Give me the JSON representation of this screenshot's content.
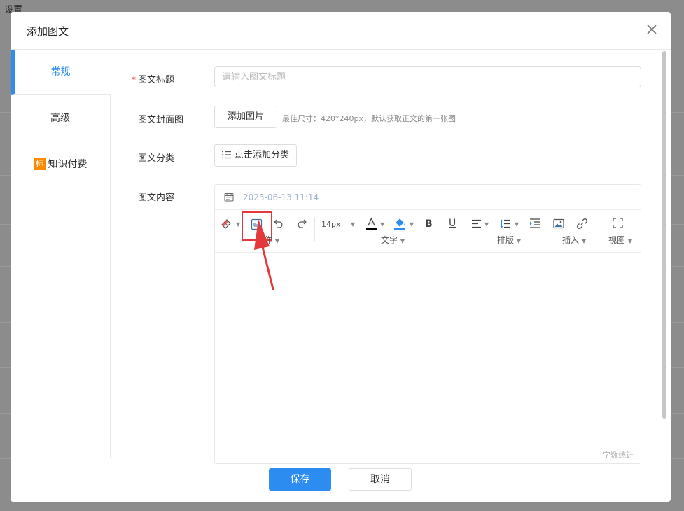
{
  "background": {
    "title": "设置"
  },
  "modal": {
    "title": "添加图文"
  },
  "sidebar": {
    "items": [
      {
        "label": "常规"
      },
      {
        "label": "高级"
      },
      {
        "badge": "标",
        "label": "知识付费"
      }
    ]
  },
  "form": {
    "title_label": "图文标题",
    "title_required": "*",
    "title_placeholder": "请输入图文标题",
    "cover_label": "图文封面图",
    "cover_button": "添加图片",
    "cover_hint": "最佳尺寸：420*240px，默认获取正文的第一张图",
    "category_label": "图文分类",
    "category_button": "点击添加分类",
    "content_label": "图文内容"
  },
  "editor": {
    "date": "2023-06-13 11:14",
    "font_size": "14px",
    "groups": {
      "operation": "操作",
      "text": "文字",
      "layout": "排版",
      "insert": "插入",
      "view": "视图"
    },
    "word_count": "字数统计",
    "colors": {
      "font_color": "#000000",
      "bg_color": "#2d8cf0"
    }
  },
  "footer": {
    "save_label": "保存",
    "cancel_label": "取消"
  },
  "colors": {
    "primary": "#2d8cf0",
    "required": "#e4393c",
    "badge": "#ff8a00",
    "annotation": "#e4393c"
  }
}
